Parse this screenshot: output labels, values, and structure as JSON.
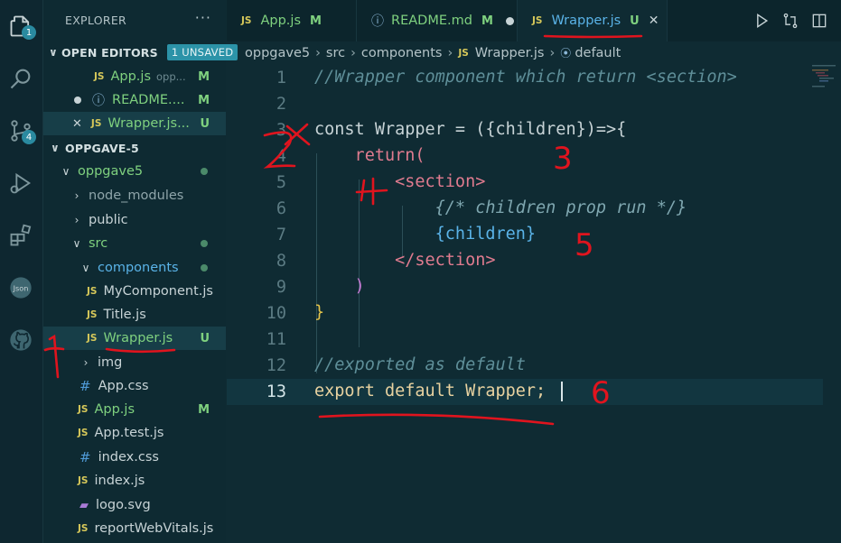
{
  "activity_bar": {
    "explorer_badge": "1",
    "scm_badge": "4"
  },
  "sidebar": {
    "title": "EXPLORER",
    "more": "···",
    "open_editors": {
      "header": "OPEN EDITORS",
      "badge": "1 UNSAVED",
      "items": [
        {
          "icon": "JS",
          "name": "App.js",
          "hint": "opp...",
          "status": "M"
        },
        {
          "icon": "i",
          "name": "README....",
          "status": "M"
        },
        {
          "icon": "JS",
          "name": "Wrapper.js...",
          "status": "U"
        }
      ]
    },
    "project": {
      "header": "OPPGAVE-5",
      "tree": [
        {
          "label": "oppgave5"
        },
        {
          "label": "node_modules"
        },
        {
          "label": "public"
        },
        {
          "label": "src"
        },
        {
          "label": "components"
        },
        {
          "label": "MyComponent.js",
          "icon": "JS"
        },
        {
          "label": "Title.js",
          "icon": "JS"
        },
        {
          "label": "Wrapper.js",
          "icon": "JS",
          "status": "U"
        },
        {
          "label": "img"
        },
        {
          "label": "App.css",
          "icon": "#"
        },
        {
          "label": "App.js",
          "icon": "JS",
          "status": "M"
        },
        {
          "label": "App.test.js",
          "icon": "JS"
        },
        {
          "label": "index.css",
          "icon": "#"
        },
        {
          "label": "index.js",
          "icon": "JS"
        },
        {
          "label": "logo.svg"
        },
        {
          "label": "reportWebVitals.js",
          "icon": "JS"
        }
      ]
    }
  },
  "tabs": [
    {
      "icon": "JS",
      "label": "App.js",
      "status": "M"
    },
    {
      "label": "README.md",
      "status": "M"
    },
    {
      "icon": "JS",
      "label": "Wrapper.js",
      "status": "U",
      "close": "✕"
    }
  ],
  "breadcrumb": [
    "oppgave5",
    "src",
    "components",
    "Wrapper.js",
    "default"
  ],
  "breadcrumb_js": "JS",
  "editor": {
    "line_numbers": [
      "1",
      "2",
      "3",
      "4",
      "5",
      "6",
      "7",
      "8",
      "9",
      "10",
      "11",
      "12",
      "13"
    ],
    "lines": [
      "//Wrapper component which return <section>",
      "",
      "const Wrapper = ({children})=>{",
      "    return(",
      "        <section>",
      "            {/* children prop run */}",
      "            {children}",
      "        </section>",
      "    )",
      "}",
      "",
      "//exported as default",
      "export default Wrapper;"
    ]
  },
  "annotations": [
    "1",
    "2",
    "3",
    "4",
    "5",
    "6"
  ],
  "colors": {
    "background": "#0f2b33",
    "sidebar": "#0e2a32",
    "accent": "#2c93a8",
    "annotation": "#e0141e",
    "modified": "#7fd17f",
    "js_icon": "#d6c85a"
  }
}
